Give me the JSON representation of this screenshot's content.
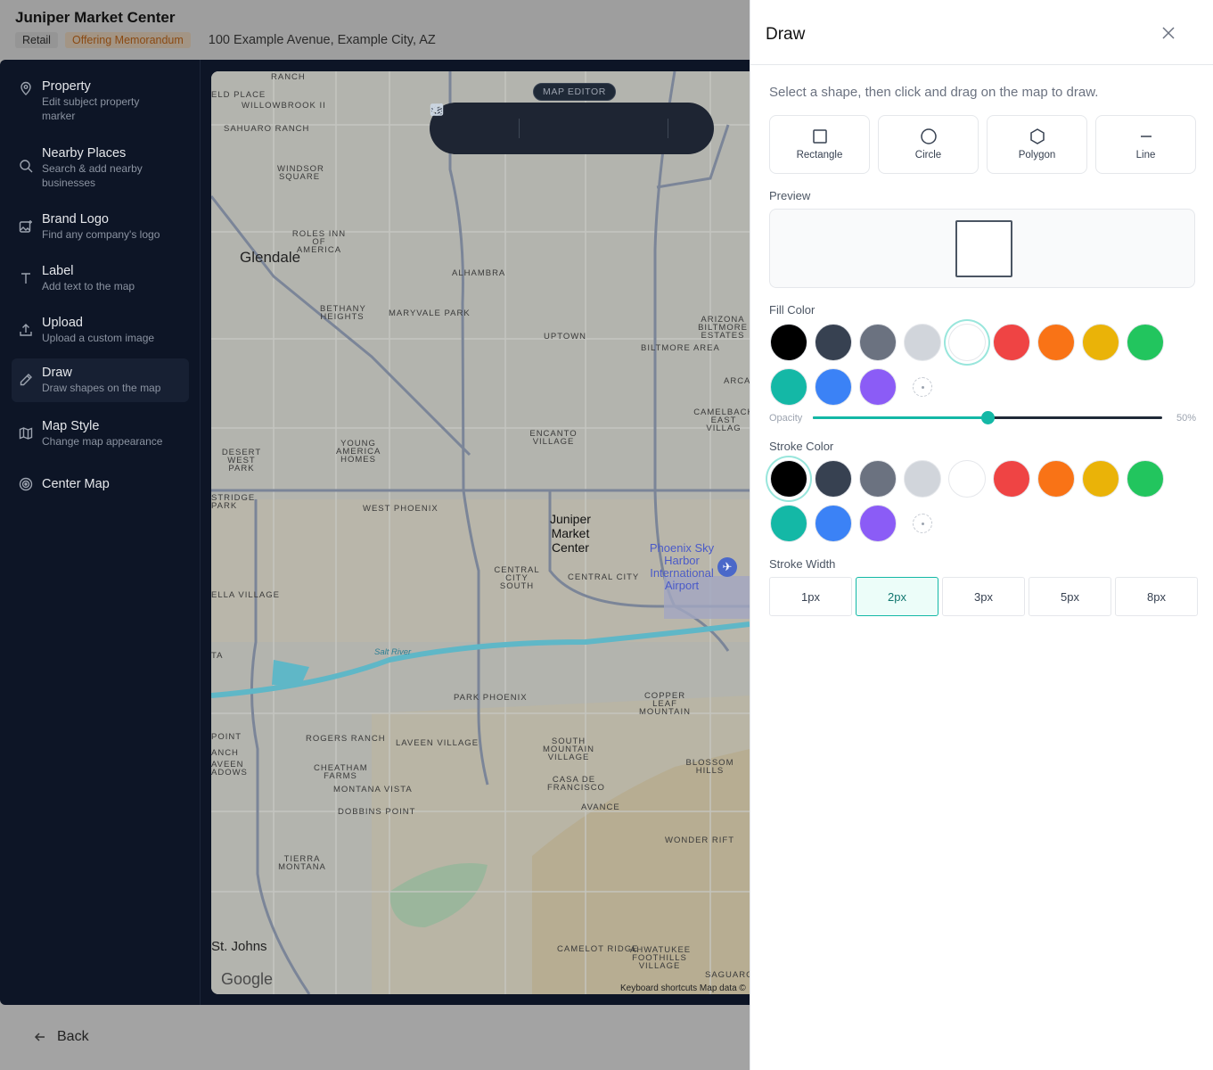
{
  "header": {
    "title": "Juniper Market Center",
    "badges": [
      "Retail",
      "Offering Memorandum"
    ],
    "address": "100 Example Avenue, Example City, AZ"
  },
  "sidebar": {
    "items": [
      {
        "title": "Property",
        "subtitle": "Edit subject property marker",
        "icon": "pin-icon"
      },
      {
        "title": "Nearby Places",
        "subtitle": "Search & add nearby businesses",
        "icon": "search-icon"
      },
      {
        "title": "Brand Logo",
        "subtitle": "Find any company's logo",
        "icon": "image-add-icon"
      },
      {
        "title": "Label",
        "subtitle": "Add text to the map",
        "icon": "text-icon"
      },
      {
        "title": "Upload",
        "subtitle": "Upload a custom image",
        "icon": "upload-icon"
      },
      {
        "title": "Draw",
        "subtitle": "Draw shapes on the map",
        "icon": "pencil-icon",
        "active": true
      },
      {
        "title": "Map Style",
        "subtitle": "Change map appearance",
        "icon": "map-icon"
      },
      {
        "title": "Center Map",
        "subtitle": "",
        "icon": "target-icon"
      }
    ],
    "back_label": "Back"
  },
  "map": {
    "editor_label": "MAP EDITOR",
    "toolbar": [
      "undo-icon",
      "redo-icon",
      "text-icon",
      "image-icon",
      "path-icon",
      "layers-icon"
    ],
    "marker": {
      "line1": "Juniper",
      "line2": "Market",
      "line3": "Center"
    },
    "cities": [
      "Glendale",
      "St. Johns"
    ],
    "labels": [
      "RANCH",
      "ELD PLACE",
      "WILLOWBROOK II",
      "SAHUARO RANCH",
      "WINDSOR SQUARE",
      "ROLES INN OF AMERICA",
      "ALHAMBRA",
      "BETHANY HEIGHTS",
      "MARYVALE PARK",
      "UPTOWN",
      "ARIZONA BILTMORE ESTATES",
      "BILTMORE AREA",
      "ARCA",
      "CAMELBACK EAST VILLAG",
      "ENCANTO VILLAGE",
      "DESERT WEST PARK",
      "YOUNG AMERICA HOMES",
      "STRIDGE PARK",
      "WEST PHOENIX",
      "CENTRAL CITY SOUTH",
      "CENTRAL CITY",
      "ELLA VILLAGE",
      "PARK PHOENIX",
      "COPPER LEAF MOUNTAIN",
      "ROGERS RANCH",
      "LAVEEN VILLAGE",
      "SOUTH MOUNTAIN VILLAGE",
      "BLOSSOM HILLS",
      "CHEATHAM FARMS",
      "MONTANA VISTA",
      "CASA DE FRANCISCO",
      "AVANCE",
      "DOBBINS POINT",
      "WONDER RIFT",
      "TIERRA MONTANA",
      "CAMELOT RIDGE",
      "AHWATUKEE FOOTHILLS VILLAGE",
      "SAGUARO",
      "POINT",
      "ANCH",
      "AVEEN ADOWS",
      "TA"
    ],
    "airport": "Phoenix Sky Harbor International Airport",
    "river": "Salt River",
    "google": "Google",
    "attribution": "Keyboard shortcuts    Map data ©"
  },
  "panel": {
    "title": "Draw",
    "hint": "Select a shape, then click and drag on the map to draw.",
    "shapes": [
      {
        "label": "Rectangle",
        "icon": "square-icon"
      },
      {
        "label": "Circle",
        "icon": "circle-icon"
      },
      {
        "label": "Polygon",
        "icon": "hexagon-icon"
      },
      {
        "label": "Line",
        "icon": "line-icon"
      }
    ],
    "preview_label": "Preview",
    "fill_label": "Fill Color",
    "opacity_label": "Opacity",
    "opacity_value": "50%",
    "opacity_fraction": 0.5,
    "stroke_label": "Stroke Color",
    "stroke_width_label": "Stroke Width",
    "colors": [
      "#000000",
      "#374151",
      "#6b7280",
      "#d1d5db",
      "#ffffff",
      "#ef4444",
      "#f97316",
      "#eab308",
      "#22c55e",
      "#14b8a6",
      "#3b82f6",
      "#8b5cf6"
    ],
    "fill_selected": "#ffffff",
    "stroke_selected": "#000000",
    "widths": [
      "1px",
      "2px",
      "3px",
      "5px",
      "8px"
    ],
    "width_selected": "2px"
  }
}
